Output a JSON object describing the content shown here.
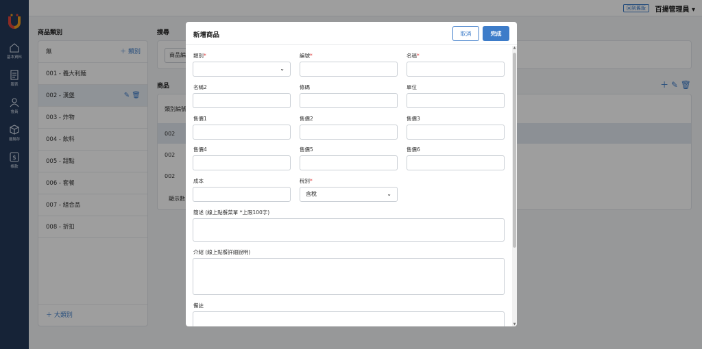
{
  "topbar": {
    "switch_label": "回到舊版",
    "user_label": "百揚管理員 ▾"
  },
  "rail": {
    "items": [
      "基本資料",
      "報表",
      "會員",
      "進銷存",
      "帳款"
    ]
  },
  "categories": {
    "title": "商品類別",
    "header": "無",
    "add_label": "＋ 類別",
    "items": [
      "001 - 義大利麵",
      "002 - 漢堡",
      "003 - 炸物",
      "004 - 飲料",
      "005 - 甜點",
      "006 - 套餐",
      "007 - 組合品",
      "008 - 折扣"
    ],
    "add_major_label": "＋ 大類別"
  },
  "search": {
    "title": "搜尋",
    "field_label": "商品編"
  },
  "products": {
    "title": "商品",
    "col_label": "類別編號",
    "rows": [
      "002",
      "002",
      "002"
    ],
    "footer": "顯示數"
  },
  "modal": {
    "title": "新增商品",
    "cancel_label": "取消",
    "done_label": "完成",
    "fields": {
      "category": "類別",
      "code": "編號",
      "name": "名稱",
      "name2": "名稱2",
      "barcode": "條碼",
      "unit": "單位",
      "price1": "售價1",
      "price2": "售價2",
      "price3": "售價3",
      "price4": "售價4",
      "price5": "售價5",
      "price6": "售價6",
      "cost": "成本",
      "tax": "稅別",
      "tax_value": "含稅",
      "brief": "簡述 (線上點餐菜單 *上限100字)",
      "intro": "介紹 (線上點餐詳細說明)",
      "note": "備註"
    },
    "required_mark": "*"
  },
  "colors": {
    "accent": "#3d7cc9",
    "rail": "#24395a",
    "required": "#dd3333"
  }
}
